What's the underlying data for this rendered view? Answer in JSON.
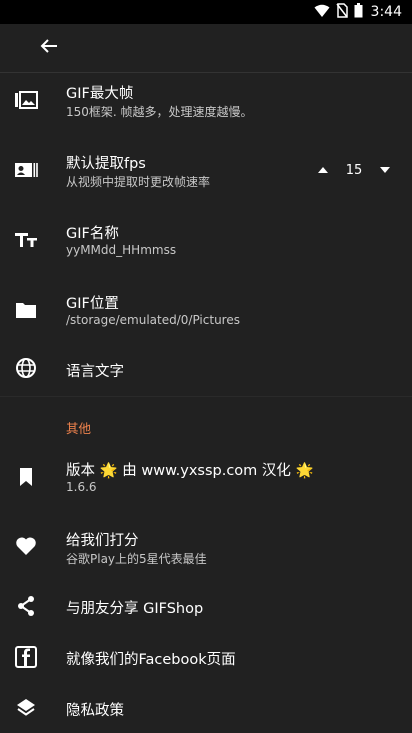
{
  "status": {
    "time": "3:44"
  },
  "settings": {
    "gif_max_frames": {
      "title": "GIF最大帧",
      "subtitle": "150框架. 帧越多，处理速度越慢。"
    },
    "default_fps": {
      "title": "默认提取fps",
      "subtitle": "从视频中提取时更改帧速率",
      "value": "15"
    },
    "gif_name": {
      "title": "GIF名称",
      "subtitle": "yyMMdd_HHmmss"
    },
    "gif_location": {
      "title": "GIF位置",
      "subtitle": "/storage/emulated/0/Pictures"
    },
    "language": {
      "title": "语言文字"
    }
  },
  "other": {
    "section_title": "其他",
    "version": {
      "title": "版本 🌟 由 www.yxssp.com 汉化 🌟",
      "subtitle": "1.6.6"
    },
    "rate": {
      "title": "给我们打分",
      "subtitle": "谷歌Play上的5星代表最佳"
    },
    "share": {
      "title": "与朋友分享 GIFShop"
    },
    "facebook": {
      "title": "就像我们的Facebook页面"
    },
    "privacy": {
      "title": "隐私政策"
    }
  },
  "colors": {
    "background": "#212121",
    "accent": "#f0834d",
    "statusbar": "#000000"
  },
  "icons": {
    "max_frames": "photo-library-icon",
    "fps": "contact-card-icon",
    "name": "text-fields-icon",
    "location": "folder-icon",
    "language": "globe-icon",
    "version": "bookmark-icon",
    "rate": "heart-icon",
    "share": "share-icon",
    "facebook": "facebook-icon",
    "privacy": "layers-icon"
  }
}
